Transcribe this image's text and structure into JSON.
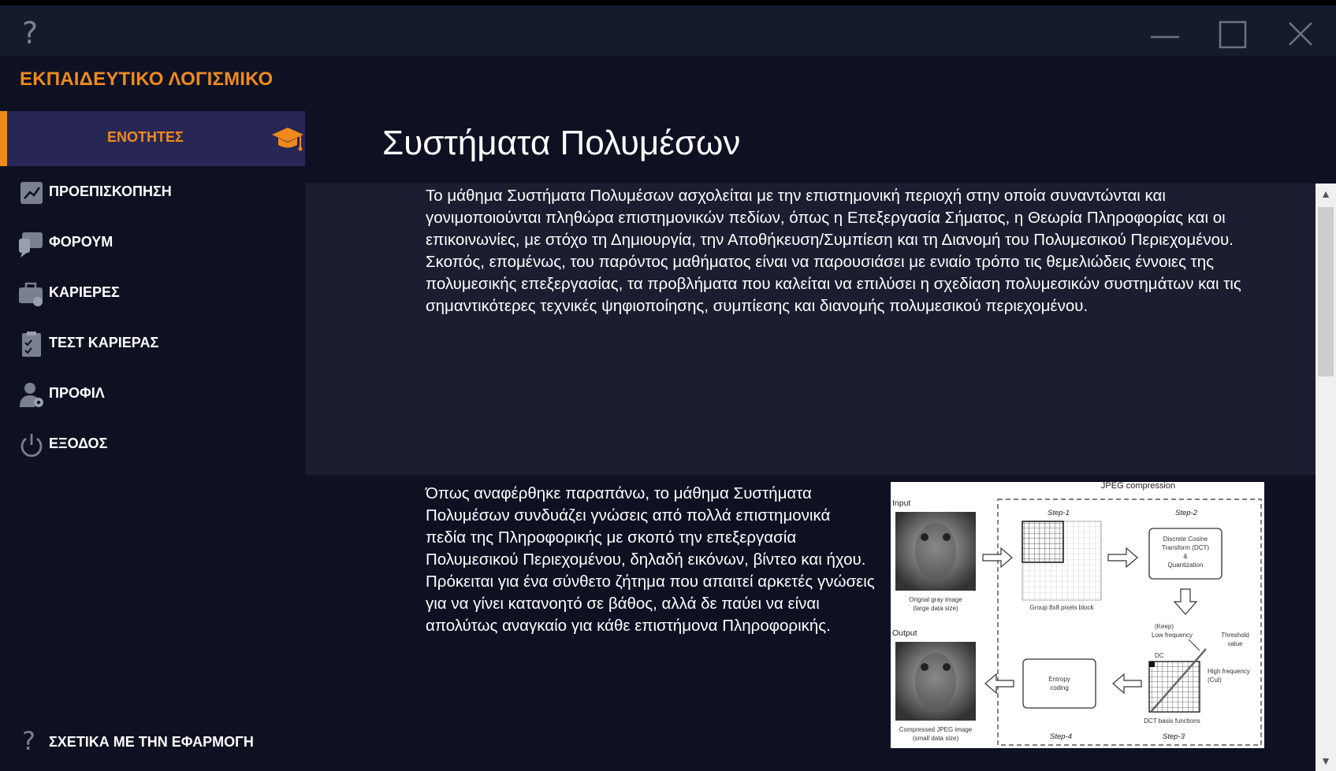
{
  "window": {
    "help_icon": "question-icon",
    "minimize_icon": "minimize-icon",
    "maximize_icon": "maximize-icon",
    "close_icon": "close-icon"
  },
  "sidebar": {
    "app_title": "ΕΚΠΑΙΔΕΥΤΙΚΟ ΛΟΓΙΣΜΙΚΟ",
    "active_item": {
      "label": "ΕΝΟΤΗΤΕΣ",
      "icon": "graduation-cap-icon"
    },
    "items": [
      {
        "label": "ΠΡΟΕΠΙΣΚΟΠΗΣΗ",
        "icon": "chart-icon"
      },
      {
        "label": "ΦΟΡΟΥΜ",
        "icon": "forum-icon"
      },
      {
        "label": "ΚΑΡΙΕΡΕΣ",
        "icon": "briefcase-icon"
      },
      {
        "label": "ΤΕΣΤ ΚΑΡΙΕΡΑΣ",
        "icon": "clipboard-icon"
      },
      {
        "label": "ΠΡΟΦΙΛ",
        "icon": "user-settings-icon"
      },
      {
        "label": "ΕΞΟΔΟΣ",
        "icon": "power-icon"
      }
    ],
    "about": {
      "label": "ΣΧΕΤΙΚΑ ΜΕ ΤΗΝ ΕΦΑΡΜΟΓΗ",
      "icon": "question-icon"
    }
  },
  "main": {
    "title": "Συστήματα Πολυμέσων",
    "intro": "Το μάθημα Συστήματα Πολυμέσων ασχολείται με την επιστημονική περιοχή στην οποία συναντώνται και γονιμοποιούνται πληθώρα επιστημονικών πεδίων, όπως η Επεξεργασία Σήματος, η Θεωρία Πληροφορίας και οι επικοινωνίες, με στόχο τη Δημιουργία, την Αποθήκευση/Συμπίεση και τη Διανομή του Πολυμεσικού Περιεχομένου. Σκοπός, επομένως, του παρόντος μαθήματος είναι να παρουσιάσει με ενιαίο τρόπο τις θεμελιώδεις έννοιες της πολυμεσικής επεξεργασίας, τα προβλήματα που καλείται να επιλύσει η σχεδίαση πολυμεσικών συστημάτων και τις σημαντικότερες τεχνικές ψηφιοποίησης, συμπίεσης και διανομής πολυμεσικού περιεχομένου.",
    "paragraph2": "Όπως αναφέρθηκε παραπάνω, το μάθημα Συστήματα Πολυμέσων συνδυάζει γνώσεις από πολλά επιστημονικά πεδία της Πληροφορικής με σκοπό την επεξεργασία Πολυμεσικού Περιεχομένου, δηλαδή εικόνων, βίντεο και ήχου. Πρόκειται για ένα σύνθετο ζήτημα που απαιτεί αρκετές γνώσεις για να γίνει κατανοητό σε βάθος, αλλά δε παύει να είναι απολύτως αναγκαίο για κάθε επιστήμονα Πληροφορικής."
  },
  "figure": {
    "title": "JPEG compression",
    "input_label": "Input",
    "output_label": "Output",
    "original_caption_1": "Orignal gray image",
    "original_caption_2": "(large data size)",
    "compressed_caption_1": "Compressed JPEG image",
    "compressed_caption_2": "(small data size)",
    "step1": "Step-1",
    "step2": "Step-2",
    "step3": "Step-3",
    "step4": "Step-4",
    "group_caption": "Group 8x8 pixels block",
    "dct_line1": "Discrete Cosine",
    "dct_line2": "Transform (DCT)",
    "dct_line3": "&",
    "dct_line4": "Quantization",
    "keep_line1": "(Keep)",
    "keep_line2": "Low frequency",
    "threshold_line1": "Threshold",
    "threshold_line2": "value",
    "dc_label": "DC",
    "high_line1": "High frequency",
    "high_line2": "(Cut)",
    "basis_caption": "DCT basis functions",
    "entropy_line1": "Entropy",
    "entropy_line2": "coding"
  }
}
